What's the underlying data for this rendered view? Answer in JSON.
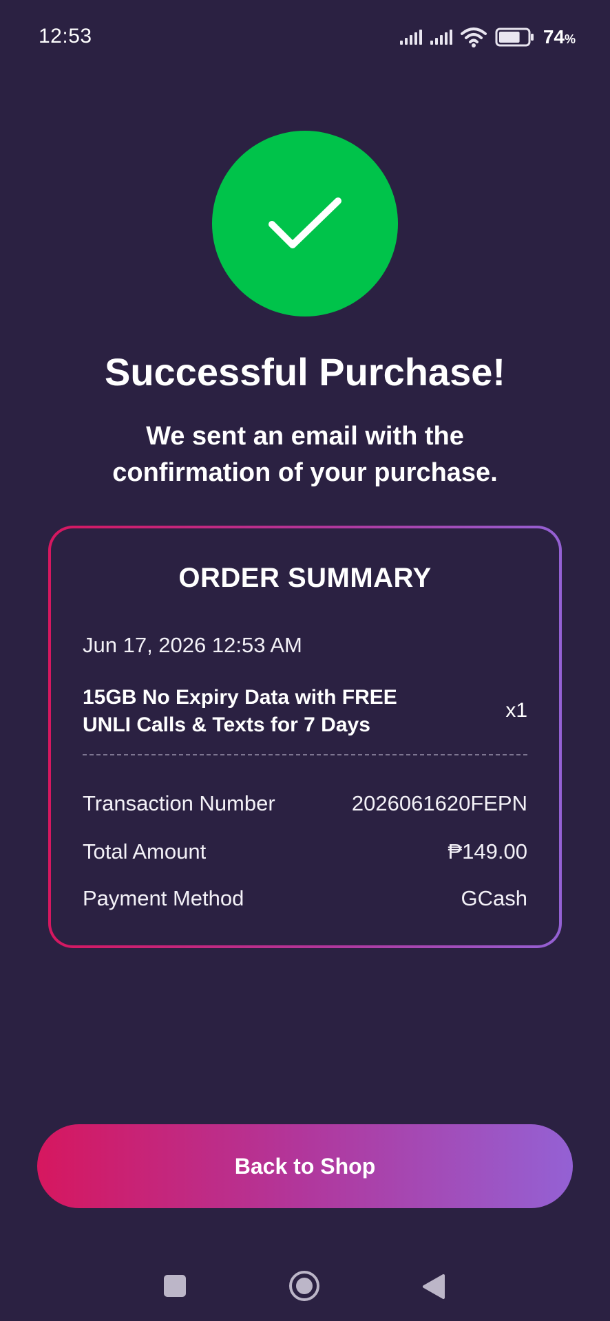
{
  "status_bar": {
    "time": "12:53",
    "battery_percent": "74",
    "battery_unit": "%",
    "battery_level": 0.74,
    "icons": [
      "signal-icon",
      "signal-icon",
      "wifi-icon",
      "battery-icon"
    ]
  },
  "success": {
    "icon": "checkmark-icon",
    "icon_color": "#00c34a",
    "title": "Successful Purchase!",
    "subtitle": "We sent an email with the confirmation of your purchase."
  },
  "order_summary": {
    "title": "ORDER SUMMARY",
    "date": "Jun 17, 2026 12:53 AM",
    "item": {
      "name": "15GB No Expiry Data with FREE UNLI Calls & Texts for 7 Days",
      "quantity": "x1"
    },
    "rows": [
      {
        "label": "Transaction Number",
        "value": "2026061620FEPN"
      },
      {
        "label": "Total Amount",
        "value": "₱149.00"
      },
      {
        "label": "Payment Method",
        "value": "GCash"
      }
    ]
  },
  "actions": {
    "back_to_shop": "Back to Shop"
  },
  "colors": {
    "background": "#2b2142",
    "gradient_start": "#d6175f",
    "gradient_end": "#9461d4"
  },
  "nav_bar": {
    "icons": [
      "recent-apps-icon",
      "home-icon",
      "back-icon"
    ]
  }
}
